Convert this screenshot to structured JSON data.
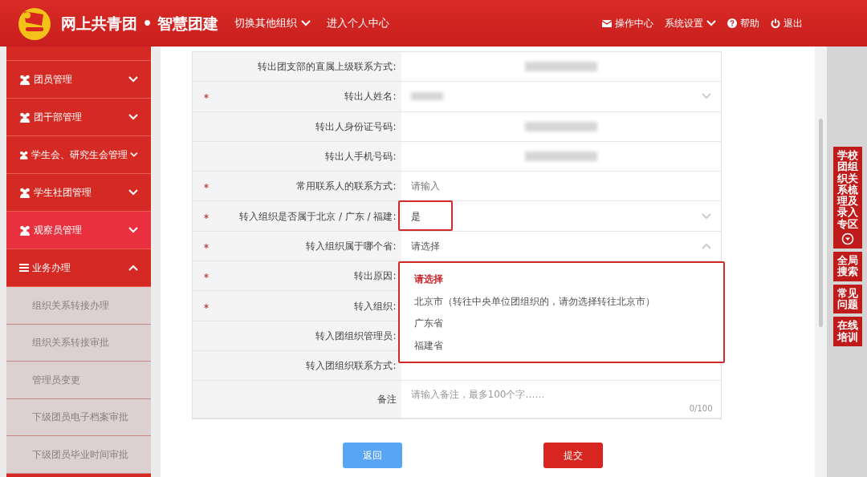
{
  "header": {
    "title": "网上共青团 • 智慧团建",
    "nav": [
      {
        "label": "切换其他组织",
        "dropdown": true
      },
      {
        "label": "进入个人中心",
        "dropdown": false
      }
    ],
    "right_menu": [
      {
        "label": "操作中心",
        "kind": "mail",
        "dropdown": false
      },
      {
        "label": "系统设置",
        "kind": "none",
        "dropdown": true
      },
      {
        "label": "帮助",
        "kind": "help",
        "dropdown": false
      },
      {
        "label": "退出",
        "kind": "power",
        "dropdown": false
      }
    ]
  },
  "sidebar": {
    "items": [
      {
        "label": "团员管理",
        "kind": "group",
        "expanded": false,
        "selected": false
      },
      {
        "label": "团干部管理",
        "kind": "group",
        "expanded": false,
        "selected": false
      },
      {
        "label": "学生会、研究生会管理",
        "kind": "group",
        "expanded": false,
        "selected": false
      },
      {
        "label": "学生社团管理",
        "kind": "group",
        "expanded": false,
        "selected": false
      },
      {
        "label": "观察员管理",
        "kind": "group",
        "expanded": false,
        "selected": true
      },
      {
        "label": "业务办理",
        "kind": "list",
        "expanded": true,
        "selected": false,
        "children": [
          {
            "label": "组织关系转接办理"
          },
          {
            "label": "组织关系转接审批"
          },
          {
            "label": "管理员变更"
          },
          {
            "label": "下级团员电子档案审批"
          },
          {
            "label": "下级团员毕业时间审批"
          }
        ]
      }
    ]
  },
  "form": {
    "rows": [
      {
        "label": "转出团支部的直属上级联系方式:",
        "required": false,
        "kind": "redacted"
      },
      {
        "label": "转出人姓名:",
        "required": true,
        "kind": "select",
        "redacted": true,
        "expanded": false
      },
      {
        "label": "转出人身份证号码:",
        "required": false,
        "kind": "redacted"
      },
      {
        "label": "转出人手机号码:",
        "required": false,
        "kind": "redacted"
      },
      {
        "label": "常用联系人的联系方式:",
        "required": true,
        "kind": "input",
        "placeholder": "请输入"
      },
      {
        "label": "转入组织是否属于北京 / 广东 / 福建:",
        "required": true,
        "kind": "select",
        "value": "是",
        "expanded": false,
        "highlighted": true
      },
      {
        "label": "转入组织属于哪个省:",
        "required": true,
        "kind": "select",
        "placeholder": "请选择",
        "expanded": true
      },
      {
        "label": "转出原因:",
        "required": true,
        "kind": "empty"
      },
      {
        "label": "转入组织:",
        "required": true,
        "kind": "empty"
      },
      {
        "label": "转入团组织管理员:",
        "required": false,
        "kind": "empty"
      },
      {
        "label": "转入团组织联系方式:",
        "required": false,
        "kind": "empty"
      },
      {
        "label": "备注",
        "required": false,
        "kind": "textarea",
        "placeholder": "请输入备注，最多100个字……",
        "counter": "0/100"
      }
    ],
    "dropdown": {
      "highlighted": true,
      "options": [
        {
          "label": "请选择",
          "selected": true
        },
        {
          "label": "北京市（转往中央单位团组织的，请勿选择转往北京市）",
          "selected": false
        },
        {
          "label": "广东省",
          "selected": false
        },
        {
          "label": "福建省",
          "selected": false
        }
      ]
    },
    "buttons": [
      {
        "label": "返回",
        "kind": "secondary"
      },
      {
        "label": "提交",
        "kind": "primary"
      }
    ]
  },
  "side_tabs": [
    {
      "label": "学校团组织关系梳理及录入专区",
      "icon": true
    },
    {
      "label": "全局搜索",
      "icon": false
    },
    {
      "label": "常见问题",
      "icon": false
    },
    {
      "label": "在线培训",
      "icon": false
    }
  ]
}
